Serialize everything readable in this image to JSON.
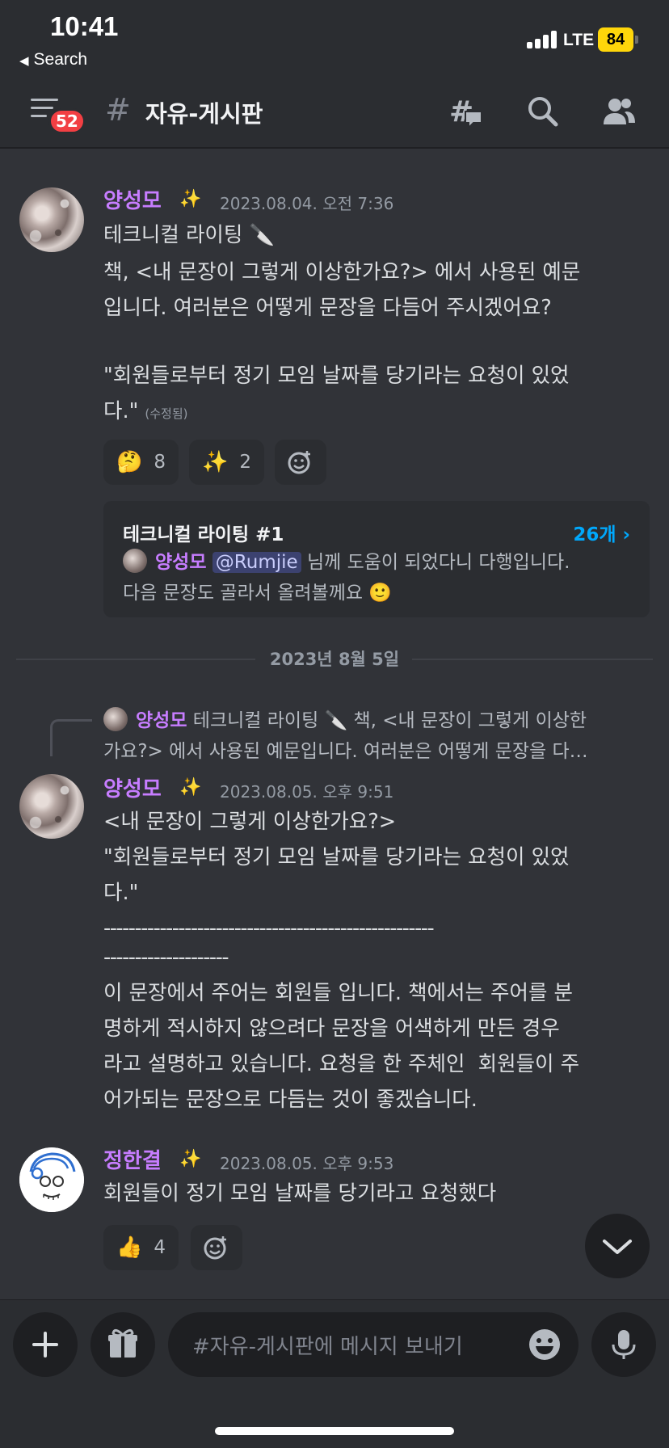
{
  "status_bar": {
    "time": "10:41",
    "back_label": "Search",
    "network": "LTE",
    "battery": "84"
  },
  "header": {
    "badge_count": "52",
    "channel_name": "자유-게시판"
  },
  "messages": [
    {
      "author": "양성모",
      "timestamp": "2023.08.04. 오전 7:36",
      "lines": [
        "테크니컬 라이팅 🔪",
        "책, <내 문장이 그렇게 이상한가요?> 에서 사용된 예문",
        "입니다. 여러분은 어떻게 문장을 다듬어 주시겠어요?",
        "",
        "\"회원들로부터 정기 모임 날짜를 당기라는 요청이 있었",
        "다.\""
      ],
      "edited_label": "(수정됨)",
      "reactions": [
        {
          "emoji": "🤔",
          "count": "8"
        },
        {
          "emoji": "✨",
          "count": "2"
        }
      ],
      "thread": {
        "title": "테크니컬 라이팅 #1",
        "count": "26개 ›",
        "author": "양성모",
        "mention": "@Rumjie",
        "line1": " 님께 도움이 되었다니 다행입니다.",
        "line2": "다음 문장도 골라서 올려볼께요 🙂"
      }
    },
    {
      "author": "양성모",
      "timestamp": "2023.08.05. 오후 9:51",
      "reply": {
        "author": "양성모",
        "line1": " 테크니컬 라이팅 🔪 책, <내 문장이 그렇게 이상한",
        "line2": "가요?> 에서 사용된 예문입니다. 여러분은 어떻게 문장을 다…"
      },
      "lines": [
        "<내 문장이 그렇게 이상한가요?>",
        "\"회원들로부터 정기 모임 날짜를 당기라는 요청이 있었",
        "다.\"",
        "-----------------------------------------------------",
        "--------------------",
        "이 문장에서 주어는 회원들 입니다. 책에서는 주어를 분",
        "명하게 적시하지 않으려다 문장을 어색하게 만든 경우",
        "라고 설명하고 있습니다. 요청을 한 주체인  회원들이 주",
        "어가되는 문장으로 다듬는 것이 좋겠습니다."
      ]
    },
    {
      "author": "정한결",
      "timestamp": "2023.08.05. 오후 9:53",
      "lines": [
        "회원들이 정기 모임 날짜를 당기라고 요청했다"
      ],
      "reactions": [
        {
          "emoji": "👍",
          "count": "4"
        }
      ]
    }
  ],
  "date_divider": "2023년 8월 5일",
  "composer": {
    "placeholder": "#자유-게시판에 메시지 보내기"
  },
  "icons": {
    "sparkle": "✨",
    "channel": "#",
    "header_right": [
      "threads-icon",
      "search-icon",
      "members-icon"
    ],
    "composer": [
      "plus-icon",
      "gift-icon",
      "emoji-icon",
      "microphone-icon"
    ]
  },
  "colors": {
    "username": "#c77dff",
    "thread_count": "#00a8fc",
    "badge": "#f23f43",
    "battery": "#ffd60a"
  }
}
